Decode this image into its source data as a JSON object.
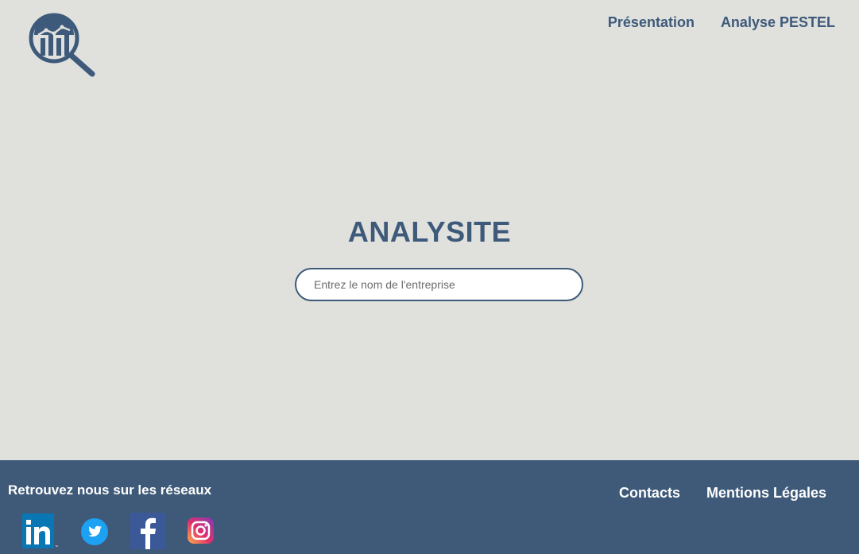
{
  "header": {
    "logo_icon": "magnifier-chart-icon",
    "nav": [
      {
        "label": "Présentation"
      },
      {
        "label": "Analyse PESTEL"
      }
    ]
  },
  "hero": {
    "title": "ANALYSITE",
    "search_placeholder": "Entrez le nom de l'entreprise",
    "search_value": ""
  },
  "footer": {
    "social_title": "Retrouvez nous sur les réseaux",
    "social_icons": [
      "linkedin-icon",
      "twitter-icon",
      "facebook-icon",
      "instagram-icon"
    ],
    "links": [
      {
        "label": "Contacts"
      },
      {
        "label": "Mentions Légales"
      }
    ]
  },
  "colors": {
    "background": "#e0e0dd",
    "primary": "#3e5a7a",
    "footer": "#3f5a78",
    "linkedin": "#0a77b5",
    "twitter": "#1da1f2",
    "facebook": "#3b5998"
  }
}
